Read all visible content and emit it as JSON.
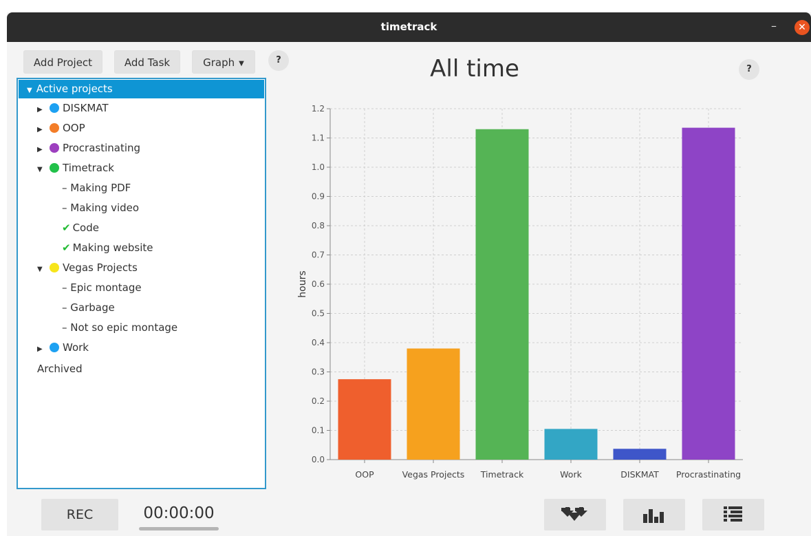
{
  "window": {
    "title": "timetrack",
    "minimize_glyph": "–",
    "close_glyph": "✕"
  },
  "toolbar": {
    "add_project": "Add Project",
    "add_task": "Add Task",
    "graph": "Graph",
    "help": "?"
  },
  "tree": {
    "header": "Active projects",
    "rows": [
      {
        "kind": "project",
        "label": "DISKMAT",
        "color": "#1da1f2",
        "expanded": false
      },
      {
        "kind": "project",
        "label": "OOP",
        "color": "#f37d28",
        "expanded": false
      },
      {
        "kind": "project",
        "label": "Procrastinating",
        "color": "#9d3fbf",
        "expanded": false
      },
      {
        "kind": "project",
        "label": "Timetrack",
        "color": "#22c14a",
        "expanded": true
      },
      {
        "kind": "task",
        "label": "Making PDF",
        "done": false
      },
      {
        "kind": "task",
        "label": "Making video",
        "done": false
      },
      {
        "kind": "task",
        "label": "Code",
        "done": true
      },
      {
        "kind": "task",
        "label": "Making website",
        "done": true
      },
      {
        "kind": "project",
        "label": "Vegas Projects",
        "color": "#f7e51b",
        "expanded": true
      },
      {
        "kind": "task",
        "label": "Epic montage",
        "done": false
      },
      {
        "kind": "task",
        "label": "Garbage",
        "done": false
      },
      {
        "kind": "task",
        "label": "Not so epic montage",
        "done": false
      },
      {
        "kind": "project",
        "label": "Work",
        "color": "#1da1f2",
        "expanded": false
      }
    ],
    "archived": "Archived"
  },
  "chart_title": "All time",
  "chart_help": "?",
  "chart_data": {
    "type": "bar",
    "categories": [
      "OOP",
      "Vegas Projects",
      "Timetrack",
      "Work",
      "DISKMAT",
      "Procrastinating"
    ],
    "values": [
      0.275,
      0.38,
      1.13,
      0.105,
      0.037,
      1.135
    ],
    "colors": [
      "#ef5f2d",
      "#f6a11e",
      "#55b455",
      "#33a6c5",
      "#3e56c9",
      "#8e44c6"
    ],
    "ylabel": "hours",
    "ylim": [
      0,
      1.2
    ],
    "yticks": [
      "0.0",
      "0.1",
      "0.2",
      "0.3",
      "0.4",
      "0.5",
      "0.6",
      "0.7",
      "0.8",
      "0.9",
      "1.0",
      "1.1",
      "1.2"
    ],
    "grid": true
  },
  "footer": {
    "rec": "REC",
    "timer": "00:00:00"
  }
}
